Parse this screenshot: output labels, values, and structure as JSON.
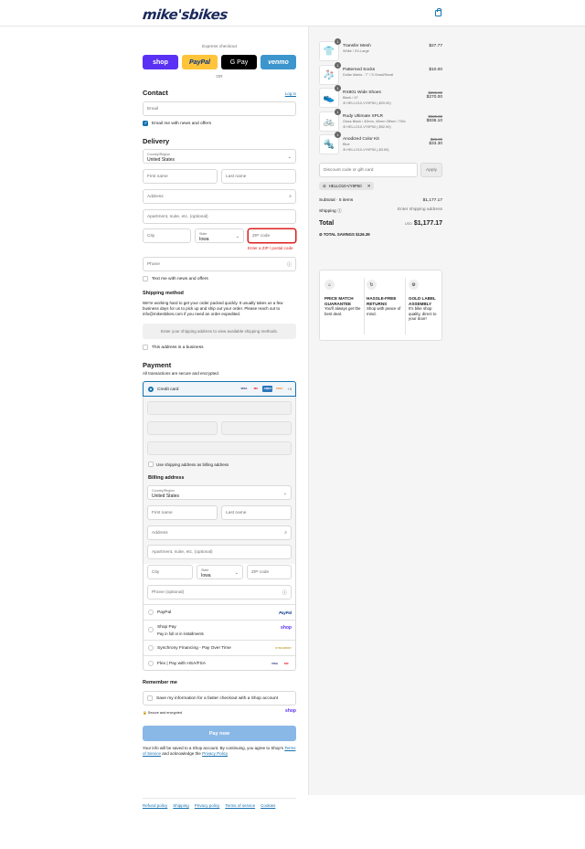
{
  "header": {
    "logo": "mike'sbikes",
    "bag_icon": "shopping-bag-icon"
  },
  "express": {
    "title": "Express checkout",
    "buttons": [
      "shop",
      "PayPal",
      "G Pay",
      "venmo"
    ],
    "or": "OR"
  },
  "contact": {
    "heading": "Contact",
    "login": "Log in",
    "email_placeholder": "Email",
    "news_label": "Email me with news and offers"
  },
  "delivery": {
    "heading": "Delivery",
    "country_label": "Country/Region",
    "country_value": "United States",
    "first_name": "First name",
    "last_name": "Last name",
    "address": "Address",
    "apt": "Apartment, suite, etc. (optional)",
    "city": "City",
    "state_label": "State",
    "state_value": "Iowa",
    "zip": "ZIP code",
    "zip_error": "Enter a ZIP / postal code",
    "phone": "Phone",
    "text_label": "Text me with news and offers"
  },
  "shipping": {
    "heading": "Shipping method",
    "text": "We're working hard to get your order packed quickly. It usually takes us a few business days for us to pick up and ship out your order. Please reach out to info@mikesbikes.com if you need an order expedited.",
    "notice": "Enter your shipping address to view available shipping methods.",
    "business_label": "This address is a business"
  },
  "payment": {
    "heading": "Payment",
    "subtext": "All transactions are secure and encrypted.",
    "credit_card": "Credit card",
    "card_badges": [
      "VISA",
      "MC",
      "AMEX",
      "DISC"
    ],
    "more_cards": "+3",
    "use_shipping": "Use shipping address as billing address",
    "billing_heading": "Billing address",
    "billing_country_label": "Country/Region",
    "billing_country": "United States",
    "first_name": "First name",
    "last_name": "Last name",
    "address": "Address",
    "apt": "Apartment, suite, etc. (optional)",
    "city": "City",
    "state_label": "State",
    "state_value": "Iowa",
    "zip": "ZIP code",
    "phone": "Phone (optional)",
    "paypal": "PayPal",
    "paypal_logo": "PayPal",
    "shoppay": "Shop Pay",
    "shoppay_sub": "Pay in full or in installments",
    "shoppay_logo": "shop",
    "synchrony": "Synchrony Financing - Pay Over Time",
    "synchrony_logo": "SYNCHRONY",
    "flex": "Flex | Pay with HSA/FSA"
  },
  "remember": {
    "heading": "Remember me",
    "save_label": "Save my information for a faster checkout with a Shop account",
    "secure": "Secure and encrypted",
    "shop": "shop"
  },
  "pay_now": "Pay now",
  "legal": {
    "text": "Your info will be saved to a Shop account. By continuing, you agree to Shop's",
    "terms": "Terms of Service",
    "and": "and acknowledge the",
    "privacy": "Privacy Policy"
  },
  "footer": [
    "Refund policy",
    "Shipping",
    "Privacy policy",
    "Terms of service",
    "Cookies"
  ],
  "summary": {
    "items": [
      {
        "qty": "1",
        "name": "Transfer Mesh",
        "variant": "White / XX-Large",
        "discount": "",
        "orig": "",
        "price": "$27.77",
        "thumb": "👕"
      },
      {
        "qty": "1",
        "name": "Patterned Socks",
        "variant": "Dollar Marks - 7\" / S-Small/Small",
        "discount": "",
        "orig": "",
        "price": "$10.00",
        "thumb": "🧦"
      },
      {
        "qty": "1",
        "name": "RX801 Wide Shoes",
        "variant": "Black / 47",
        "discount": "HELLO10-VY9P50 (-$29.90)",
        "orig": "$299.00",
        "price": "$270.00",
        "thumb": "👟"
      },
      {
        "qty": "1",
        "name": "Rudy Ultimate XPLR",
        "variant": "Gloss Black / 40mm, 40mm Offset / 700c",
        "discount": "HELLO10-VY9P50 (-$92.90)",
        "orig": "$929.00",
        "price": "$836.10",
        "thumb": "🚲"
      },
      {
        "qty": "1",
        "name": "Anodized Color Kit",
        "variant": "Blue",
        "discount": "HELLO10-VY9P50 (-$3.69)",
        "orig": "$36.99",
        "price": "$33.30",
        "thumb": "🔩"
      }
    ],
    "discount_placeholder": "Discount code or gift card",
    "apply": "Apply",
    "code": "HELLO10-VY9P50",
    "subtotal_label": "Subtotal · 5 items",
    "subtotal": "$1,177.17",
    "shipping_label": "Shipping",
    "shipping_value": "Enter shipping address",
    "total_label": "Total",
    "currency": "USD",
    "total": "$1,177.17",
    "savings_label": "TOTAL SAVINGS",
    "savings": "$126.39"
  },
  "features": [
    {
      "icon": "tag-icon",
      "title": "PRICE MATCH GUARANTEE",
      "text": "You'll always get the best deal."
    },
    {
      "icon": "wrench-icon",
      "title": "HASSLE-FREE RETURNS",
      "text": "Shop with peace of mind."
    },
    {
      "icon": "gear-icon",
      "title": "GOLD LABEL ASSEMBLY",
      "text": "It's bike shop quality, direct to your door!"
    }
  ]
}
